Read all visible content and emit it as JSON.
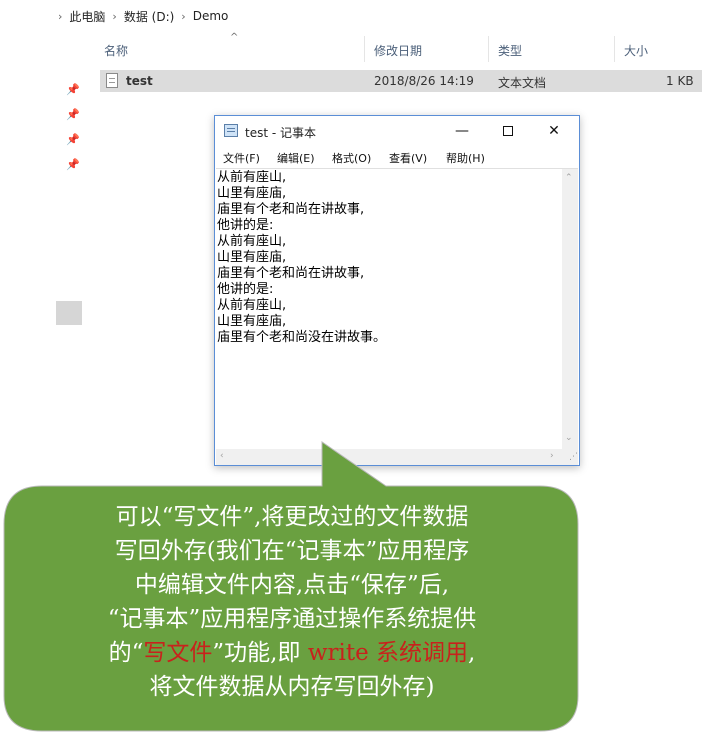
{
  "explorer": {
    "breadcrumb": [
      "此电脑",
      "数据 (D:)",
      "Demo"
    ],
    "columns": {
      "name": "名称",
      "modified": "修改日期",
      "type": "类型",
      "size": "大小"
    },
    "file": {
      "name": "test",
      "modified": "2018/8/26 14:19",
      "type": "文本文档",
      "size": "1 KB"
    }
  },
  "notepad": {
    "title": "test - 记事本",
    "menu": [
      "文件(F)",
      "编辑(E)",
      "格式(O)",
      "查看(V)",
      "帮助(H)"
    ],
    "content": "从前有座山,\n山里有座庙,\n庙里有个老和尚在讲故事,\n他讲的是:\n从前有座山,\n山里有座庙,\n庙里有个老和尚在讲故事,\n他讲的是:\n从前有座山,\n山里有座庙,\n庙里有个老和尚没在讲故事。",
    "buttons": {
      "minimize": "—",
      "close": "✕"
    }
  },
  "callout": {
    "color": "#6aa040",
    "line1": "可以“写文件”,将更改过的文件数据",
    "line2": "写回外存(我们在“记事本”应用程序",
    "line3": "中编辑文件内容,点击“保存”后,",
    "line4": "“记事本”应用程序通过操作系统提供",
    "line5_a": "的“",
    "line5_b": "写文件",
    "line5_c": "”功能,即 ",
    "line5_d": "write 系统调用",
    "line5_e": ",",
    "line6": "将文件数据从内存写回外存)"
  }
}
